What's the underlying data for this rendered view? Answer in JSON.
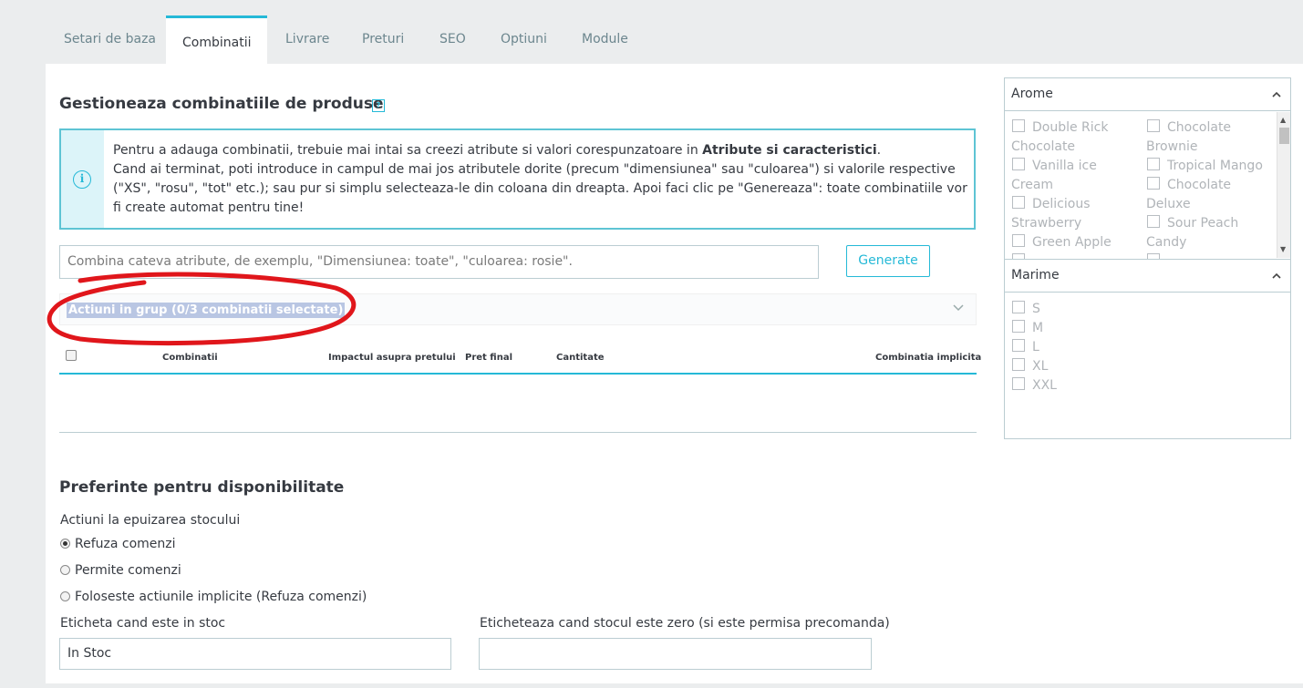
{
  "tabs": [
    {
      "label": "Setari de baza",
      "active": false
    },
    {
      "label": "Combinatii",
      "active": true
    },
    {
      "label": "Livrare",
      "active": false
    },
    {
      "label": "Preturi",
      "active": false
    },
    {
      "label": "SEO",
      "active": false
    },
    {
      "label": "Optiuni",
      "active": false
    },
    {
      "label": "Module",
      "active": false
    }
  ],
  "combinations": {
    "title": "Gestioneaza combinatiile de produse",
    "help_icon": "?",
    "info_line1_prefix": "Pentru a adauga combinatii, trebuie mai intai sa creezi atribute si valori corespunzatoare in ",
    "info_line1_link": "Atribute si caracteristici",
    "info_line1_suffix": ".",
    "info_line2": "Cand ai terminat, poti introduce in campul de mai jos atributele dorite (precum \"dimensiunea\" sau \"culoarea\") si valorile respective (\"XS\", \"rosu\", \"tot\" etc.); sau pur si simplu selecteaza-le din coloana din dreapta. Apoi faci clic pe \"Genereaza\": toate combinatiile vor fi create automat pentru tine!",
    "input_placeholder": "Combina cateva atribute, de exemplu, \"Dimensiunea: toate\", \"culoarea: rosie\".",
    "generate_label": "Generate",
    "bulk_label": "Actiuni in grup (0/3 combinatii selectate)",
    "table_headers": {
      "combinations": "Combinatii",
      "price_impact": "Impactul asupra pretului",
      "final_price": "Pret final",
      "quantity": "Cantitate",
      "default": "Combinatia implicita"
    }
  },
  "availability": {
    "title": "Preferinte pentru disponibilitate",
    "stock_label": "Actiuni la epuizarea stocului",
    "options": [
      {
        "label": "Refuza comenzi",
        "checked": true
      },
      {
        "label": "Permite comenzi",
        "checked": false
      },
      {
        "label": "Foloseste actiunile implicite (Refuza comenzi)",
        "checked": false
      }
    ],
    "in_stock_label": "Eticheta cand este in stoc",
    "in_stock_value": "In Stoc",
    "zero_stock_label": "Eticheteaza cand stocul este zero (si este permisa precomanda)",
    "zero_stock_value": ""
  },
  "sidebar": {
    "arome": {
      "title": "Arome",
      "lines_left": [
        "Double Rick",
        "Chocolate",
        "Vanilla ice",
        "Cream",
        "Delicious",
        "Strawberry",
        "Green Apple"
      ],
      "lines_right": [
        "Chocolate",
        "Brownie",
        "Tropical Mango",
        "Chocolate",
        "Deluxe",
        "Sour Peach",
        "Candy"
      ]
    },
    "marime": {
      "title": "Marime",
      "options": [
        "S",
        "M",
        "L",
        "XL",
        "XXL"
      ]
    }
  },
  "colors": {
    "accent": "#25b9d7",
    "annotation": "#e0161b"
  }
}
